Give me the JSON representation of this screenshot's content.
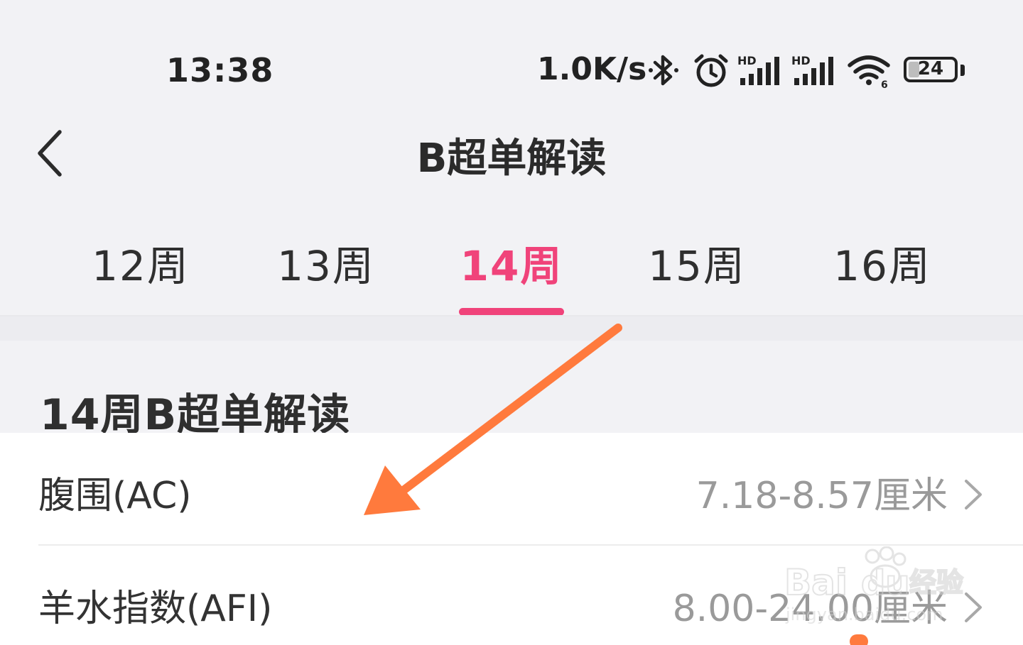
{
  "status_bar": {
    "time": "13:38",
    "network_speed": "1.0K/s",
    "battery_level": "24",
    "battery_fraction": 0.24,
    "icons": [
      "bluetooth-icon",
      "alarm-icon",
      "hd-signal-icon",
      "hd-signal-icon",
      "wifi-icon",
      "battery-icon"
    ]
  },
  "nav": {
    "title": "B超单解读",
    "back_icon": "chevron-left-icon"
  },
  "tabs": {
    "items": [
      {
        "label": "12周",
        "active": false
      },
      {
        "label": "13周",
        "active": false
      },
      {
        "label": "14周",
        "active": true
      },
      {
        "label": "15周",
        "active": false
      },
      {
        "label": "16周",
        "active": false
      }
    ],
    "active_color": "#f0437a"
  },
  "section": {
    "title": "14周B超单解读"
  },
  "list": {
    "rows": [
      {
        "label": "腹围(AC)",
        "value": "7.18-8.57厘米"
      },
      {
        "label": "羊水指数(AFI)",
        "value": "8.00-24.00厘米"
      }
    ]
  },
  "annotation": {
    "arrow_color": "#ff7a3d"
  }
}
